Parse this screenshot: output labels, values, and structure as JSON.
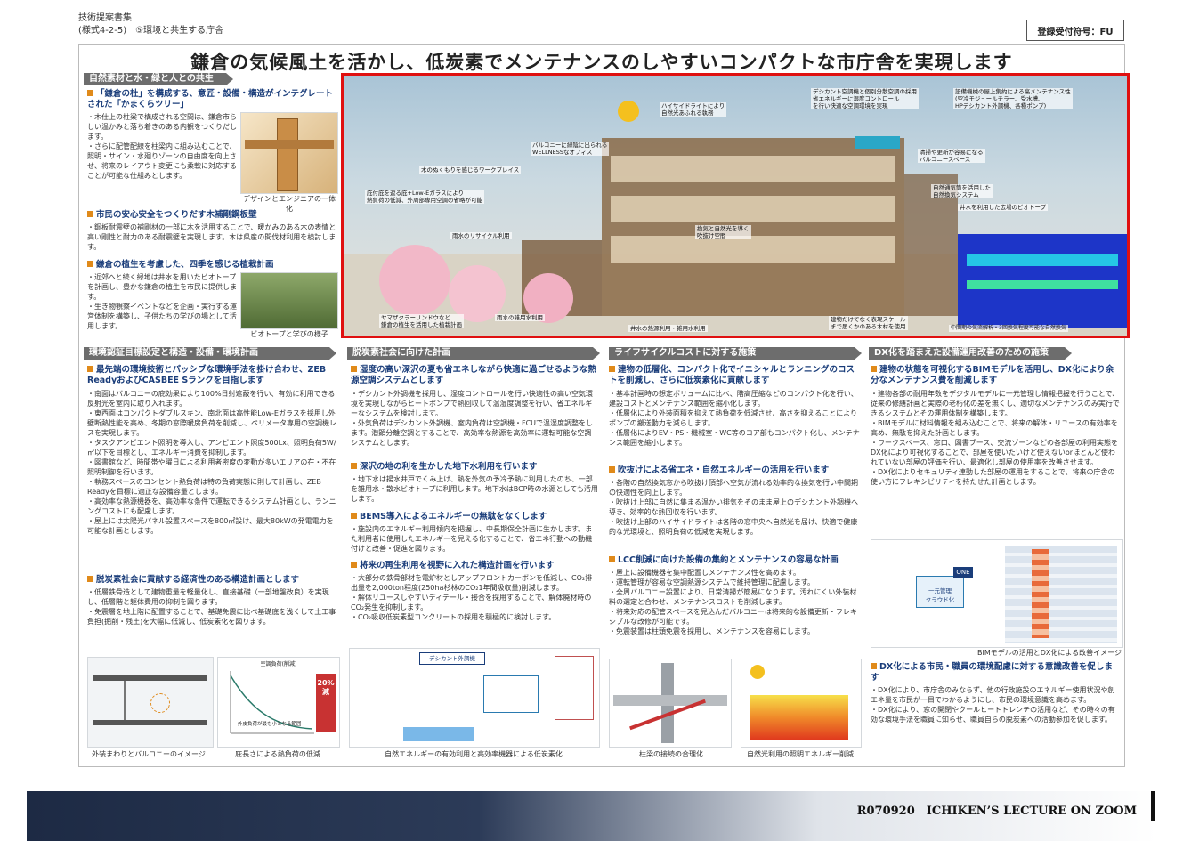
{
  "meta": {
    "line1": "技術提案書集",
    "line2": "(様式4-2-5)　⑤環境と共生する庁舎",
    "registration": "登録受付符号：FU"
  },
  "title": "鎌倉の気候風土を活かし、低炭素でメンテナンスのしやすいコンパクトな市庁舎を実現します",
  "left_top": {
    "section": "自然素材と水・緑と人との共生",
    "h1": "「鎌倉の杜」を構成する、意匠・設備・構造がインテグレートされた「かまくらツリー」",
    "b1": "・木仕上の柱梁で構成される空間は、鎌倉市らしい温かみと落ち着きのある内観をつくりだします。\n・さらに配管配線を柱梁内に組み込むことで、照明・サイン・水廻りゾーンの自由度を向上させ、将来のレイアウト変更にも柔軟に対応することが可能な仕組みとします。",
    "fig1_caption": "デザインとエンジニアの一体化",
    "h2": "市民の安心安全をつくりだす木補剛鋼板壁",
    "b2": "・鋼板耐震壁の補剛材の一部に木を活用することで、暖かみのある木の表情と高い剛性と耐力のある耐震壁を実現します。木は県産の間伐材利用を検討します。",
    "h3": "鎌倉の植生を考慮した、四季を感じる植栽計画",
    "b3": "・近郊へと続く緑地は井水を用いたビオトープを計画し、豊かな鎌倉の植生を市民に提供します。\n・生き物観察イベントなどを企画・実行する運営体制を構築し、子供たちの学びの場として活用します。",
    "fig2_caption": "ビオトープと学びの様子"
  },
  "hero": {
    "labels": [
      "ハイサイドライトにより\n自然光あふれる執務",
      "デシカント空調機と個別分散空調の採用\n省エネルギーに湿度コントロール\nを行い快適な空調環境を実現",
      "設備機械の屋上集約による高メンテナンス性\n(空冷モジュールチラー、受水槽、\nHPデシカント外調機、各種ポンプ)",
      "バルコニーに緑陰に出られる\nWELLNESSなオフィス",
      "清掃や更新が容易になる\nバルコニースペース",
      "木のぬくもりを感じるワークプレイス",
      "自然通気筒を活用した\n自然換気システム",
      "庇付庇を遮る庇+Low-Eガラスにより\n熱負荷の低減、外周部専用空調の省略が可能",
      "井水を利用した広場のビオトープ",
      "雨水のリサイクル利用",
      "換気と自然光を導く\n吹抜け空間",
      "ヤマザクラーリンドウなど\n鎌倉の植生を活用した植栽計画",
      "雨水の雑用水利用",
      "井水の熱源利用・雑用水利用",
      "建物だけでなく表現スケール\nまで届くかのある木材を使用",
      "中間期の気流解析・3回換気程度可能な自然換気"
    ]
  },
  "col1": {
    "section": "環境認証目標設定と構造・設備・環境計画",
    "h1": "最先端の環境技術とパッシブな環境手法を掛け合わせ、ZEB ReadyおよびCASBEE Sランクを目指します",
    "b1": "・南面はバルコニーの庇効果により100%日射遮蔽を行い、有効に利用できる反射光を室内に取り入れます。\n・東西面はコンパクトダブルスキン、南北面は高性能Low-Eガラスを採用し外壁断熱性能を高め、冬期の窓際暖房負荷を削減し、ペリメータ専用の空調機レスを実現します。\n・タスクアンビエント照明を導入し、アンビエント照度500Lx、照明負荷5W/㎡以下を目標とし、エネルギー消費を抑制します。\n・図書館など、時間帯や曜日による利用者密度の変動が多いエリアの在・不在照明制御を行います。\n・執務スペースのコンセント熱負荷は特の負荷実態に則して計画し、ZEB Readyを目標に適正な設備容量とします。\n・高効率な熱源機器を、高効率な条件で運転できるシステム計画とし、ランニングコストにも配慮します。\n・屋上には太陽光パネル設置スペースを800㎡設け、最大80kWの発電電力を可能な計画とします。",
    "h2": "脱炭素社会に貢献する経済性のある構造計画とします",
    "b2": "・低層鉄骨造として建物重量を軽量化し、直接基礎（一部地盤改良）を実現し、低層階と躯体費用の抑制を図ります。\n・免震層を地上階に配置することで、基礎免震に比べ基礎底を浅くして土工事負担(掘削・残土)を大幅に低減し、低炭素化を図ります。",
    "fig_caption_a": "外装まわりとバルコニーのイメージ",
    "fig_caption_b": "庇長さによる熱負荷の低減",
    "chart_title": "空調負荷(削減)",
    "chart_badge": "20%\n減",
    "chart_note": "外皮負荷が最も小となる範囲"
  },
  "col2": {
    "section": "脱炭素社会に向けた計画",
    "h1": "湿度の高い深沢の夏も省エネしながら快適に過ごせるような熱源空調システムとします",
    "b1": "・デシカント外調機を採用し、湿度コントロールを行い快適性の高い空気環境を実現しながらヒートポンプで熱回収して温湿度調整を行い、省エネルギーなシステムを検討します。\n・外気負荷はデシカント外調機、室内負荷は空調機・FCUで温湿度調整をします。潜顕分離空調とすることで、高効率な熱源を高効率に運転可能な空調システムとします。",
    "h2": "深沢の地の利を生かした地下水利用を行います",
    "b2": "・地下水は揚水井戸でくみ上げ、熱を外気の予冷予熱に利用したのち、一部を雑用水・散水ビオトープに利用します。地下水はBCP時の水源としても活用します。",
    "h3": "BEMS導入によるエネルギーの無駄をなくします",
    "b3": "・施設内のエネルギー利用傾向を把握し、中長期保全計画に生かします。また利用者に使用したエネルギーを見える化することで、省エネ行動への動機付けと改善・促進を図ります。",
    "h4": "将来の再生利用を視野に入れた構造計画を行います",
    "b4": "・大部分の鉄骨部材を電炉材としアップフロントカーボンを低減し、CO₂排出量を2,000ton程度(250ha杉林のCO₂1年間吸収量)削減します。\n・解体リユースしやすいディテール・接合を採用することで、解体廃材時のCO₂発生を抑制します。\n・CO₂吸収低炭素型コンクリートの採用を積極的に検討します。",
    "fig_caption": "自然エネルギーの有効利用と高効率機器による低炭素化",
    "fig_box": "デシカント外調機"
  },
  "col3": {
    "section": "ライフサイクルコストに対する施策",
    "h1": "建物の低層化、コンパクト化でイニシャルとランニングのコストを削減し、さらに低炭素化に貢献します",
    "b1": "・基本計画時の想定ボリュームに比べ、階高圧縮などのコンパクト化を行い、建設コストとメンテナンス範囲を縮小化します。\n・低層化により外装面積を抑えて熱負荷を低減させ、高さを抑えることによりポンプの搬送動力を減らします。\n・低層化によりEV・PS・機械室・WC等のコア部もコンパクト化し、メンテナンス範囲を縮小します。",
    "h2": "吹抜けによる省エネ・自然エネルギーの活用を行います",
    "b2": "・各階の自然換気窓から吹抜け頂部へ空気が流れる効率的な換気を行い中間期の快適性を向上します。\n・吹抜け上部に自然に集まる温かい排気をそのまま屋上のデシカント外調機へ導き、効率的な熱回収を行います。\n・吹抜け上部のハイサイドライトは各階の窓中央へ自然光を届け、快適で健康的な光環境と、照明負荷の低減を実現します。",
    "h3": "LCC削減に向けた設備の集約とメンテナンスの容易な計画",
    "b3": "・屋上に設備機器を集中配置しメンテナンス性を高めます。\n・運転管理が容易な空調熱源システムで維持管理に配慮します。\n・全周バルコニー設置により、日常清掃が簡易になります。汚れにくい外装材料の選定と合わせ、メンテナンスコストを削減します。\n・将来対応の配管スペースを見込んだバルコニーは将来的な設備更新・フレキシブルな改修が可能です。\n・免震装置は柱頭免震を採用し、メンテナンスを容易にします。",
    "fig_caption_a": "柱梁の接続の合理化",
    "fig_caption_b": "自然光利用の照明エネルギー削減"
  },
  "col4": {
    "section": "DX化を踏まえた設備運用改善のための施策",
    "h1": "建物の状態を可視化するBIMモデルを活用し、DX化により余分なメンテナンス費を削減します",
    "b1": "・建物各部の耐用年数をデジタルモデルに一元管理し情報把握を行うことで、従来の修繕計画と実際の老朽化の差を無くし、適切なメンテナンスのみ実行できるシステムとその運用体制を構築します。\n・BIMモデルに材料情報を組み込むことで、将来の解体・リユースの有効率を高め、無駄を抑えた計画とします。\n・ワークスペース、窓口、図書ブース、交流ゾーンなどの各部屋の利用実態をDX化により可視化することで、部屋を使いたいけど使えないorほとんど使われていない部屋の評価を行い、最適化し部屋の使用率を改善させます。\n・DX化によりセキュリティ連動した部屋の運用をすることで、将来の庁舎の使い方にフレキシビリティを持たせた計画とします。",
    "fig_caption": "BIMモデルの活用とDX化による改善イメージ",
    "fig_label": "一元管理\nクラウド化",
    "fig_badge": "ONE",
    "h2": "DX化による市民・職員の環境配慮に対する意識改善を促します",
    "b2": "・DX化により、市庁舎のみならず、他の行政施設のエネルギー使用状況や創エネ量を市民が一目でわかるようにし、市民の環境意識を高めます。\n・DX化により、窓の開閉やクールヒートトレンチの活用など、その時々の有効な環境手法を職員に知らせ、職員自らの脱炭素への活動参加を促します。"
  },
  "footer": {
    "text": "R070920　ICHIKEN’S LECTURE ON ZOOM"
  },
  "colors": {
    "accent": "#e01010",
    "heading": "#1a3d7a",
    "bullet": "#e08a1a",
    "section": "#6d6d6d"
  }
}
